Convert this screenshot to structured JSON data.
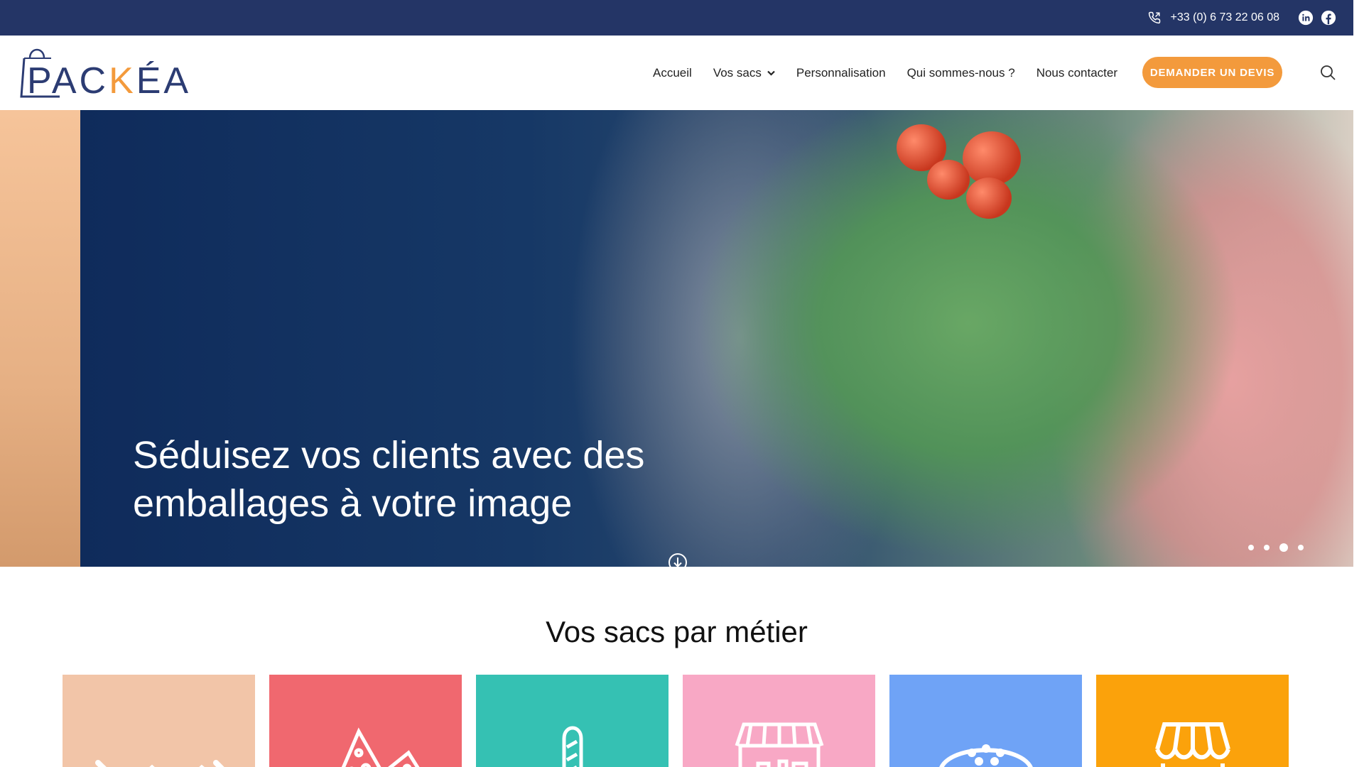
{
  "topbar": {
    "phone": "+33 (0) 6 73 22 06 08",
    "icons": [
      "phone-icon",
      "linkedin-icon",
      "facebook-icon"
    ]
  },
  "header": {
    "logo_text_a": "PAC",
    "logo_text_k": "K",
    "logo_text_b": "ÉA",
    "nav": [
      {
        "label": "Accueil"
      },
      {
        "label": "Vos sacs"
      },
      {
        "label": "Personnalisation"
      },
      {
        "label": "Qui sommes-nous ?"
      },
      {
        "label": "Nous contacter"
      }
    ],
    "cta": "DEMANDER UN DEVIS"
  },
  "hero": {
    "line1": "Séduisez vos clients avec des",
    "line2": "emballages à votre image",
    "slides": 4,
    "active_slide": 3
  },
  "section": {
    "title": "Vos sacs par métier",
    "cards": [
      {
        "icon": "sausage-icon",
        "color": "#f2c5a8"
      },
      {
        "icon": "cheese-icon",
        "color": "#f0686f"
      },
      {
        "icon": "baguette-icon",
        "color": "#35c1b3"
      },
      {
        "icon": "market-stall-icon",
        "color": "#f8a8c5"
      },
      {
        "icon": "burger-icon",
        "color": "#6fa3f6"
      },
      {
        "icon": "shop-awning-icon",
        "color": "#fba20b"
      }
    ]
  },
  "colors": {
    "topbar": "#243566",
    "accent": "#f39a3c",
    "logo": "#2c3c73"
  }
}
